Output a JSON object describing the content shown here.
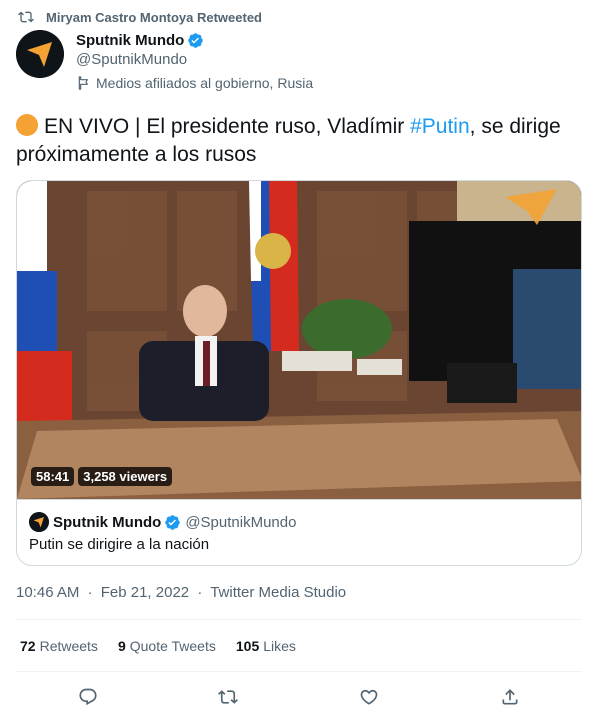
{
  "retweet_banner": {
    "text": "Miryam Castro Montoya Retweeted",
    "icon": "retweet-icon"
  },
  "author": {
    "name": "Sputnik Mundo",
    "handle": "@SputnikMundo",
    "affiliation": "Medios afiliados al gobierno, Rusia",
    "verified": true
  },
  "tweet": {
    "prefix": "EN VIVO |  El presidente ruso, Vladímir ",
    "hashtag": "#Putin",
    "suffix": ", se dirige próximamente a los rusos",
    "dot_color": "#f4a234"
  },
  "media": {
    "duration": "58:41",
    "viewers": "3,258 viewers",
    "source_name": "Sputnik Mundo",
    "source_handle": "@SputnikMundo",
    "caption": "Putin se dirigire a la nación"
  },
  "meta": {
    "time": "10:46 AM",
    "separator": "·",
    "date": "Feb 21, 2022",
    "client": "Twitter Media Studio"
  },
  "stats": {
    "retweets_count": "72",
    "retweets_label": "Retweets",
    "quotes_count": "9",
    "quotes_label": "Quote Tweets",
    "likes_count": "105",
    "likes_label": "Likes"
  },
  "colors": {
    "link": "#1d9bf0",
    "muted": "#536471",
    "text": "#0f1419",
    "brand_orange": "#f4a234"
  }
}
